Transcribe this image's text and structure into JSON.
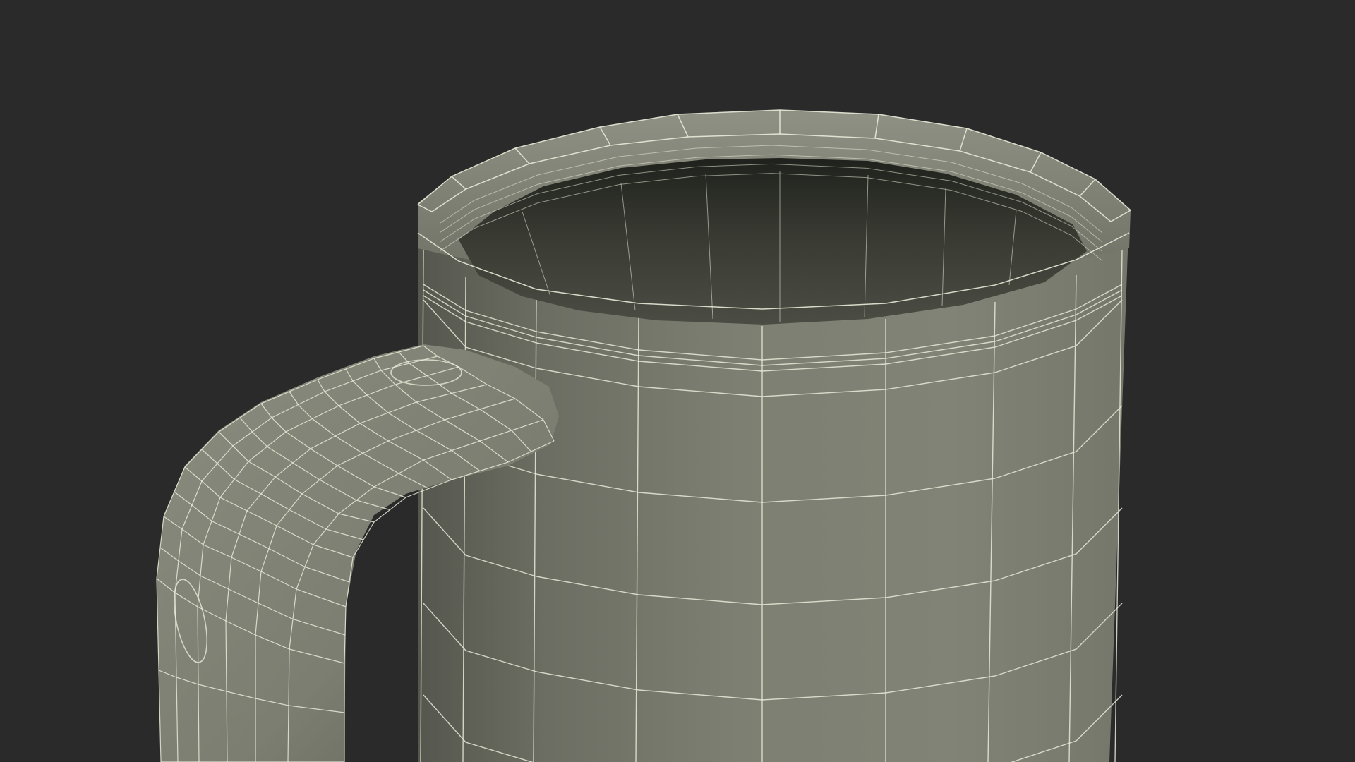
{
  "scene": {
    "subject": "mug-wireframe",
    "colors": {
      "background": "#2a2a2a",
      "body_light": "#838578",
      "body_mid": "#7a7c6f",
      "body_dark": "#5c5e54",
      "interior": "#4a4c42",
      "interior_deep": "#2f3129",
      "wire": "#e9ead8",
      "handle": "#7f8174"
    }
  }
}
